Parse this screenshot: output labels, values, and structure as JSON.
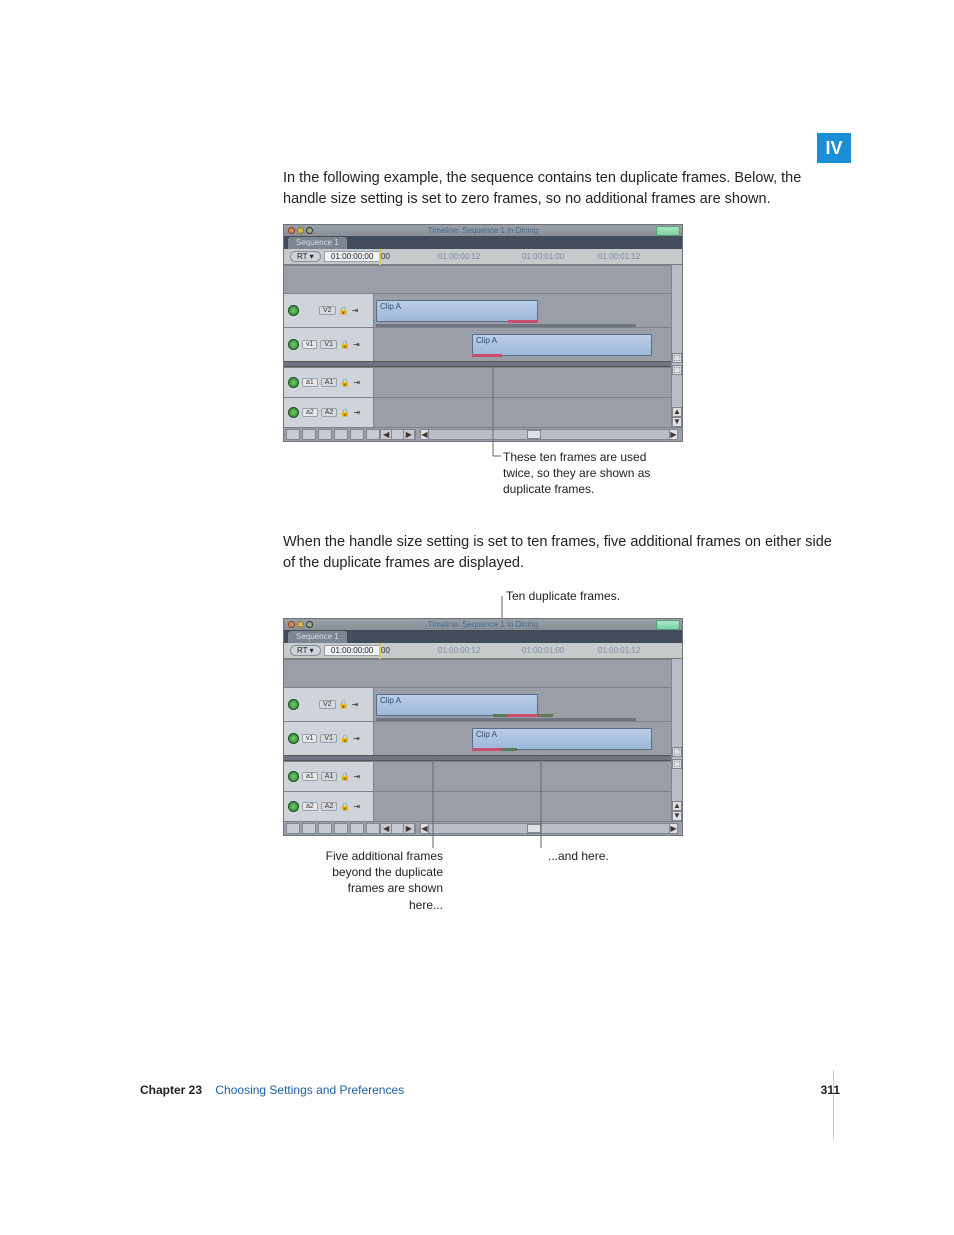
{
  "part_label": "IV",
  "para1": "In the following example, the sequence contains ten duplicate frames. Below, the handle size setting is set to zero frames, so no additional frames are shown.",
  "para2": "When the handle size setting is set to ten frames, five additional frames on either side of the duplicate frames are displayed.",
  "timeline": {
    "window_title": "Timeline: Sequence 1 in Dining",
    "tab": "Sequence 1",
    "rt_label": "RT ▾",
    "current_tc": "01:00:00;00",
    "ruler_start": "00",
    "tc1": "01:00:00:12",
    "tc2": "01:00:01:00",
    "tc3": "01:00:01:12",
    "clip_name": "Clip A",
    "tracks": {
      "v2": "V2",
      "v1": "V1",
      "v1src": "v1",
      "a1": "A1",
      "a1src": "a1",
      "a2": "A2",
      "a2src": "a2"
    }
  },
  "callouts": {
    "fig1_bottom": "These ten frames are used twice, so they are shown as duplicate frames.",
    "fig2_top": "Ten duplicate frames.",
    "fig2_left": "Five additional frames beyond the duplicate frames are shown here...",
    "fig2_right": "...and here."
  },
  "footer": {
    "chapter": "Chapter 23",
    "title": "Choosing Settings and Preferences",
    "page": "311"
  }
}
